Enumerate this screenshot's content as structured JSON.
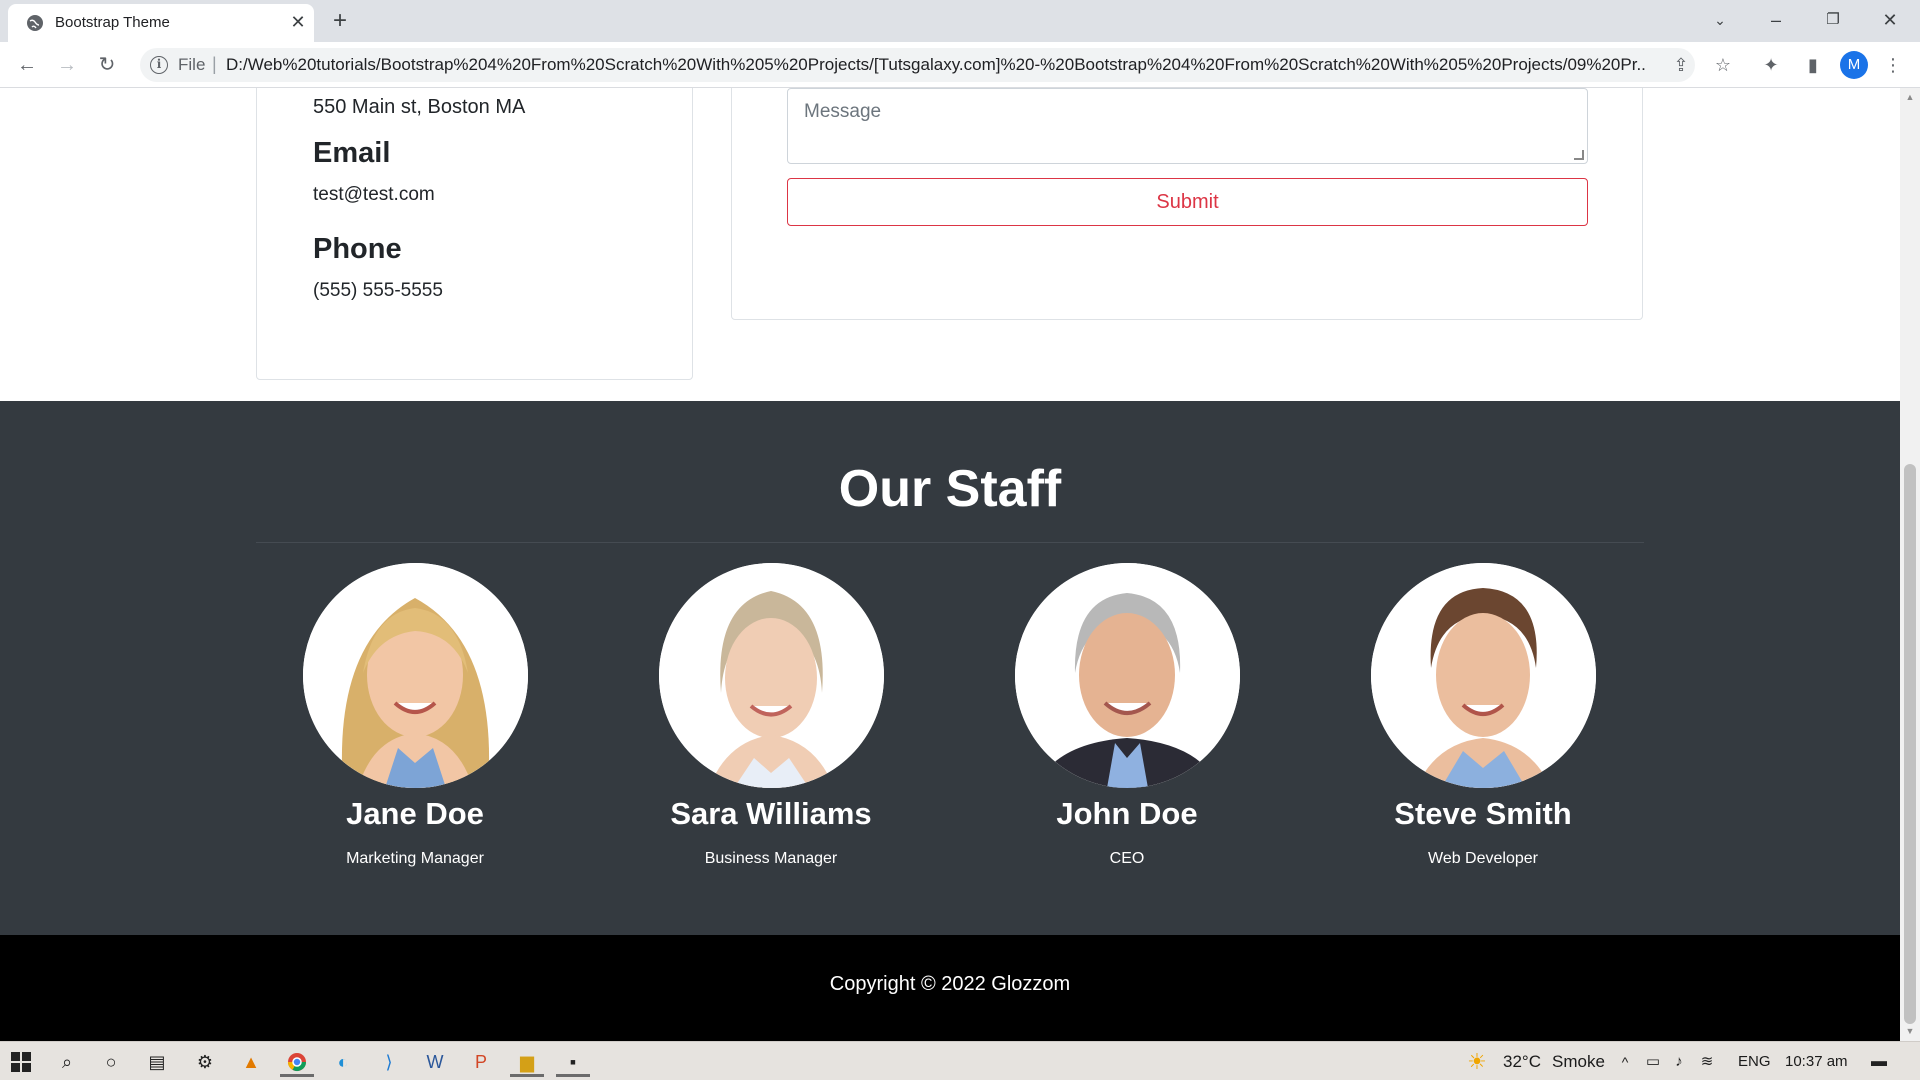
{
  "browser": {
    "tab_title": "Bootstrap Theme",
    "omnibox_scheme": "File",
    "url": "D:/Web%20tutorials/Bootstrap%204%20From%20Scratch%20With%205%20Projects/[Tutsgalaxy.com]%20-%20Bootstrap%204%20From%20Scratch%20With%205%20Projects/09%20Pr...",
    "profile_initial": "M"
  },
  "contact": {
    "address": "550 Main st, Boston MA",
    "email_heading": "Email",
    "email": "test@test.com",
    "phone_heading": "Phone",
    "phone": "(555) 555-5555"
  },
  "form": {
    "message_placeholder": "Message",
    "submit_label": "Submit"
  },
  "staff": {
    "title": "Our Staff",
    "members": [
      {
        "name": "Jane Doe",
        "role": "Marketing Manager"
      },
      {
        "name": "Sara Williams",
        "role": "Business Manager"
      },
      {
        "name": "John Doe",
        "role": "CEO"
      },
      {
        "name": "Steve Smith",
        "role": "Web Developer"
      }
    ]
  },
  "footer": {
    "copyright": "Copyright © 2022 Glozzom"
  },
  "taskbar": {
    "temperature": "32°C",
    "weather": "Smoke",
    "language": "ENG",
    "time": "10:37 am"
  }
}
